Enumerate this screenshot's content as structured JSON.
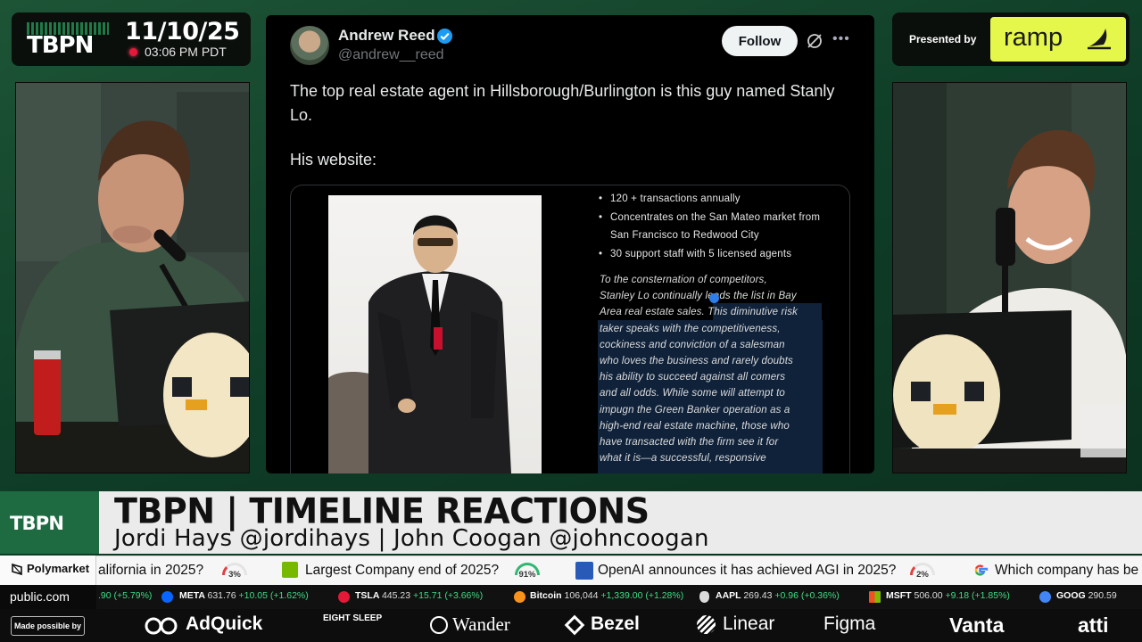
{
  "broadcast": {
    "logo": "TBPN",
    "date": "11/10/25",
    "time": "03:06 PM PDT"
  },
  "sponsor_top": {
    "presented_by": "Presented by",
    "brand": "ramp"
  },
  "tweet": {
    "author_name": "Andrew Reed",
    "handle": "@andrew__reed",
    "follow_label": "Follow",
    "text_1": "The top real estate agent in Hillsborough/Burlington is this guy named Stanly Lo.",
    "text_2": "His website:",
    "card": {
      "bullets": [
        "120 + transactions annually",
        "Concentrates on the San Mateo market from San Francisco to Redwood City",
        "30 support staff with 5 licensed agents"
      ],
      "quote_lines": [
        "To the consternation of competitors,",
        "Stanley Lo continually leads the list in Bay",
        "Area real estate sales. This diminutive risk",
        "taker speaks with the competitiveness,",
        "cockiness and conviction of a salesman",
        "who loves the business and rarely doubts",
        "his ability to succeed against all comers",
        "and all odds. While some will attempt to",
        "impugn the Green Banker operation as a",
        "high-end real estate machine, those who",
        "have transacted with the firm see it for",
        "what it is—a successful, responsive"
      ]
    }
  },
  "lower_third": {
    "logo": "TBPN",
    "title": "TBPN | TIMELINE REACTIONS",
    "hosts": "Jordi Hays @jordihays | John Coogan @johncoogan"
  },
  "polymarket": {
    "label": "Polymarket",
    "markets": [
      {
        "question": "alifornia in 2025?",
        "percent": "3%"
      },
      {
        "question": "Largest Company end of 2025?",
        "percent": "91%"
      },
      {
        "question": "OpenAI announces it has achieved AGI in 2025?",
        "percent": "2%"
      },
      {
        "question": "Which company has be",
        "percent": ""
      }
    ]
  },
  "stocks": {
    "label": "public.com",
    "items": [
      {
        "symbol": "",
        "price": ".90",
        "change": "(+5.79%)"
      },
      {
        "symbol": "META",
        "price": "631.76",
        "change": "+10.05 (+1.62%)"
      },
      {
        "symbol": "TSLA",
        "price": "445.23",
        "change": "+15.71 (+3.66%)"
      },
      {
        "symbol": "Bitcoin",
        "price": "106,044",
        "change": "+1,339.00 (+1.28%)"
      },
      {
        "symbol": "AAPL",
        "price": "269.43",
        "change": "+0.96 (+0.36%)"
      },
      {
        "symbol": "MSFT",
        "price": "506.00",
        "change": "+9.18 (+1.85%)"
      },
      {
        "symbol": "GOOG",
        "price": "290.59",
        "change": ""
      }
    ]
  },
  "sponsors_bottom": {
    "made_possible": "Made possible by",
    "brands": [
      "AdQuick",
      "EIGHT SLEEP",
      "Wander",
      "Bezel",
      "Linear",
      "Figma",
      "Vanta",
      "atti"
    ]
  },
  "colors": {
    "background": "#0f3d27",
    "tbpn_green": "#1e6b42",
    "ramp_yellow": "#e6f74b",
    "live_red": "#e8183a",
    "ticker_green": "#3ddc84"
  }
}
